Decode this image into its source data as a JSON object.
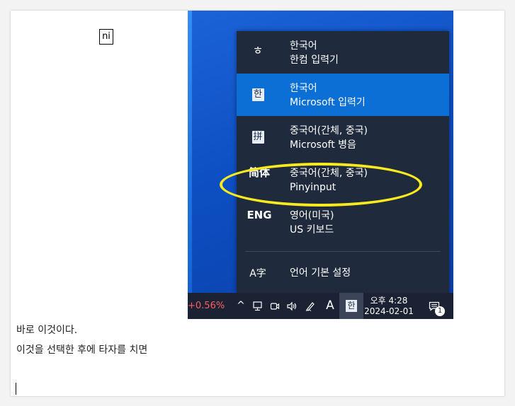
{
  "overlay_label": "ni",
  "ime_menu": {
    "items": [
      {
        "icon": "ㅎ",
        "icon_name": "hangul-h-icon",
        "language": "한국어",
        "method": "한컴 입력기",
        "selected": false
      },
      {
        "icon": "한",
        "icon_name": "hangul-han-icon",
        "language": "한국어",
        "method": "Microsoft 입력기",
        "selected": true
      },
      {
        "icon": "拼",
        "icon_name": "pinyin-icon",
        "language": "중국어(간체, 중국)",
        "method": "Microsoft 병음",
        "selected": false
      },
      {
        "icon": "简体",
        "icon_name": "simplified-chinese-icon",
        "language": "중국어(간체, 중국)",
        "method": "Pinyinput",
        "selected": false
      },
      {
        "icon": "ENG",
        "icon_name": "english-icon",
        "language": "영어(미국)",
        "method": "US 키보드",
        "selected": false
      }
    ],
    "settings": {
      "icon": "A字",
      "icon_name": "language-settings-icon",
      "label": "언어 기본 설정"
    }
  },
  "taskbar": {
    "stock": "+0.56%",
    "chevron": "^",
    "network_icon": "network-icon",
    "meet_icon": "meet-now-icon",
    "volume_icon": "volume-icon",
    "pen_icon": "pen-icon",
    "ime_mode": "A",
    "ime_lang": "한",
    "clock": {
      "time": "오후 4:28",
      "date": "2024-02-01"
    },
    "notification_icon": "notification-icon",
    "notification_count": "1"
  },
  "body_lines": [
    "바로 이것이다.",
    "이것을 선택한 후에 타자를 치면"
  ],
  "colors": {
    "selected": "#0b6fd6",
    "menu_bg": "#1f2a3c",
    "highlight": "#f8ea1f",
    "stock": "#ff5f5f"
  }
}
